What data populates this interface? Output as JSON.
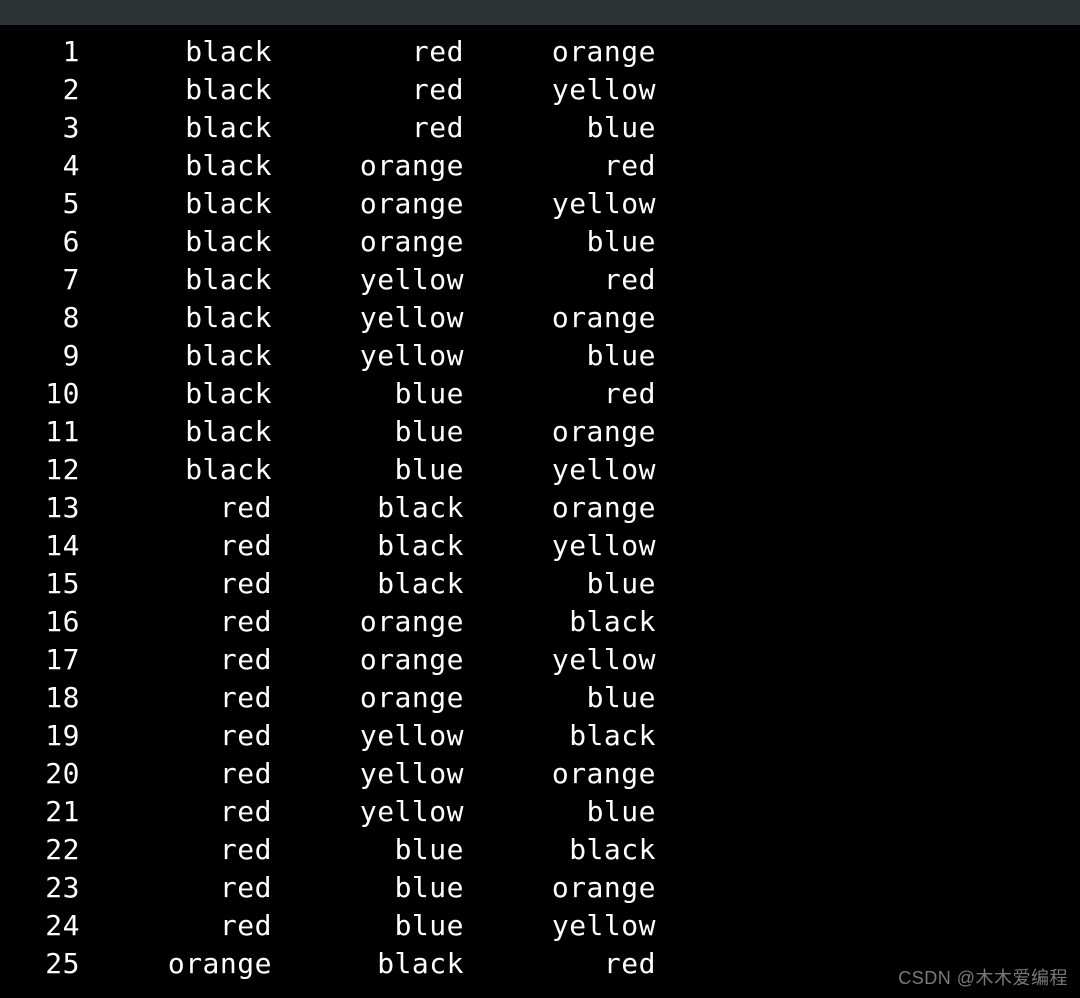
{
  "watermark": "CSDN @木木爱编程",
  "rows": [
    {
      "idx": "1",
      "c1": "black",
      "c2": "red",
      "c3": "orange"
    },
    {
      "idx": "2",
      "c1": "black",
      "c2": "red",
      "c3": "yellow"
    },
    {
      "idx": "3",
      "c1": "black",
      "c2": "red",
      "c3": "blue"
    },
    {
      "idx": "4",
      "c1": "black",
      "c2": "orange",
      "c3": "red"
    },
    {
      "idx": "5",
      "c1": "black",
      "c2": "orange",
      "c3": "yellow"
    },
    {
      "idx": "6",
      "c1": "black",
      "c2": "orange",
      "c3": "blue"
    },
    {
      "idx": "7",
      "c1": "black",
      "c2": "yellow",
      "c3": "red"
    },
    {
      "idx": "8",
      "c1": "black",
      "c2": "yellow",
      "c3": "orange"
    },
    {
      "idx": "9",
      "c1": "black",
      "c2": "yellow",
      "c3": "blue"
    },
    {
      "idx": "10",
      "c1": "black",
      "c2": "blue",
      "c3": "red"
    },
    {
      "idx": "11",
      "c1": "black",
      "c2": "blue",
      "c3": "orange"
    },
    {
      "idx": "12",
      "c1": "black",
      "c2": "blue",
      "c3": "yellow"
    },
    {
      "idx": "13",
      "c1": "red",
      "c2": "black",
      "c3": "orange"
    },
    {
      "idx": "14",
      "c1": "red",
      "c2": "black",
      "c3": "yellow"
    },
    {
      "idx": "15",
      "c1": "red",
      "c2": "black",
      "c3": "blue"
    },
    {
      "idx": "16",
      "c1": "red",
      "c2": "orange",
      "c3": "black"
    },
    {
      "idx": "17",
      "c1": "red",
      "c2": "orange",
      "c3": "yellow"
    },
    {
      "idx": "18",
      "c1": "red",
      "c2": "orange",
      "c3": "blue"
    },
    {
      "idx": "19",
      "c1": "red",
      "c2": "yellow",
      "c3": "black"
    },
    {
      "idx": "20",
      "c1": "red",
      "c2": "yellow",
      "c3": "orange"
    },
    {
      "idx": "21",
      "c1": "red",
      "c2": "yellow",
      "c3": "blue"
    },
    {
      "idx": "22",
      "c1": "red",
      "c2": "blue",
      "c3": "black"
    },
    {
      "idx": "23",
      "c1": "red",
      "c2": "blue",
      "c3": "orange"
    },
    {
      "idx": "24",
      "c1": "red",
      "c2": "blue",
      "c3": "yellow"
    },
    {
      "idx": "25",
      "c1": "orange",
      "c2": "black",
      "c3": "red"
    }
  ]
}
